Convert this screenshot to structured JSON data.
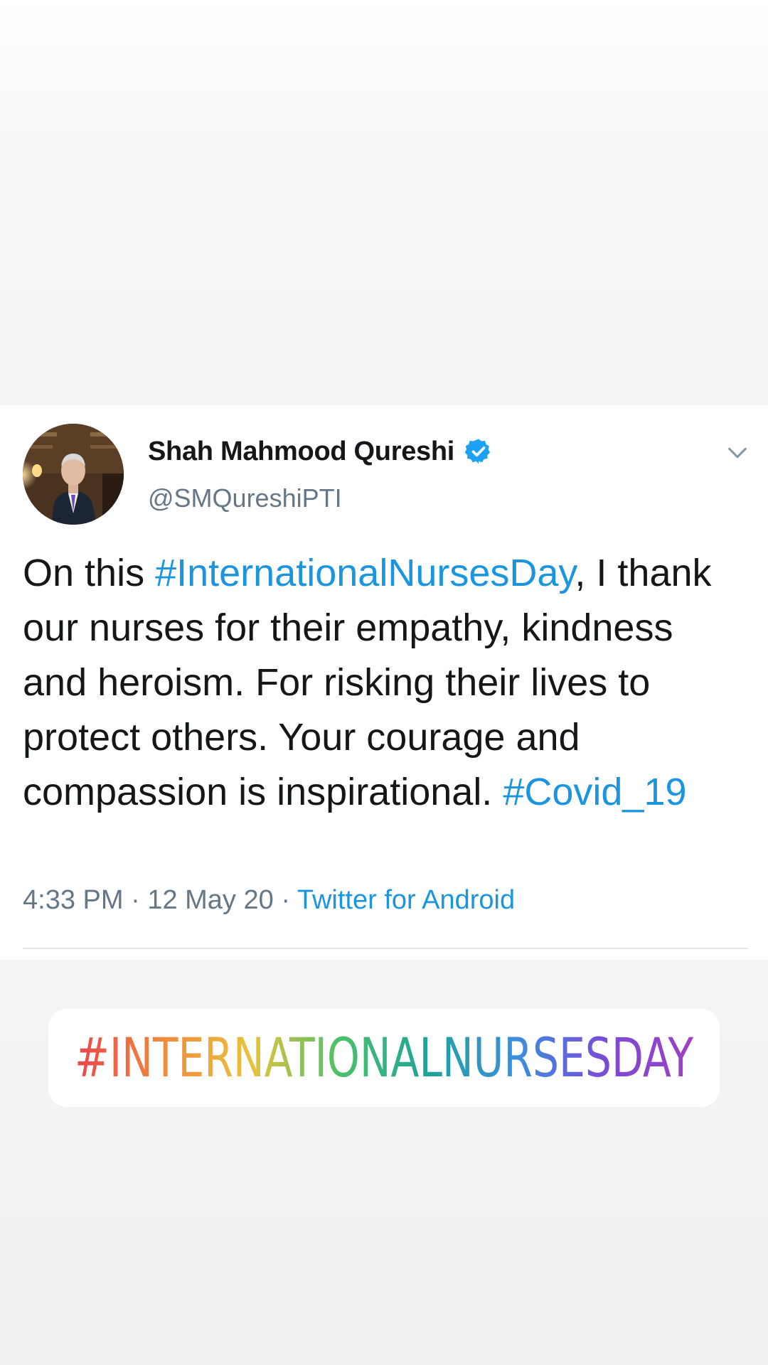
{
  "tweet": {
    "display_name": "Shah Mahmood Qureshi",
    "handle": "@SMQureshiPTI",
    "text_parts": {
      "p1": "On this ",
      "hashtag1": "#InternationalNursesDay",
      "p2": ", I thank our nurses for their empathy, kindness and heroism. For risking their lives to protect others. Your courage and compassion is inspirational. ",
      "hashtag2": "#Covid_19"
    },
    "time": "4:33 PM",
    "separator": " · ",
    "date": "12 May 20",
    "source": "Twitter for Android",
    "icons": {
      "avatar": "avatar",
      "verified": "verified-badge-icon",
      "menu": "chevron-down-icon"
    }
  },
  "sticker": {
    "text": "#INTERNATIONALNURSESDAY",
    "gradient_colors": [
      "#e8454a",
      "#f08a3c",
      "#e9c23c",
      "#4cc06a",
      "#1fa39a",
      "#3b8ee0",
      "#7b4bd6",
      "#9c3fc4"
    ]
  },
  "colors": {
    "link": "#1b95e0",
    "text": "#14171a",
    "muted": "#657786",
    "verified": "#1da1f2"
  }
}
